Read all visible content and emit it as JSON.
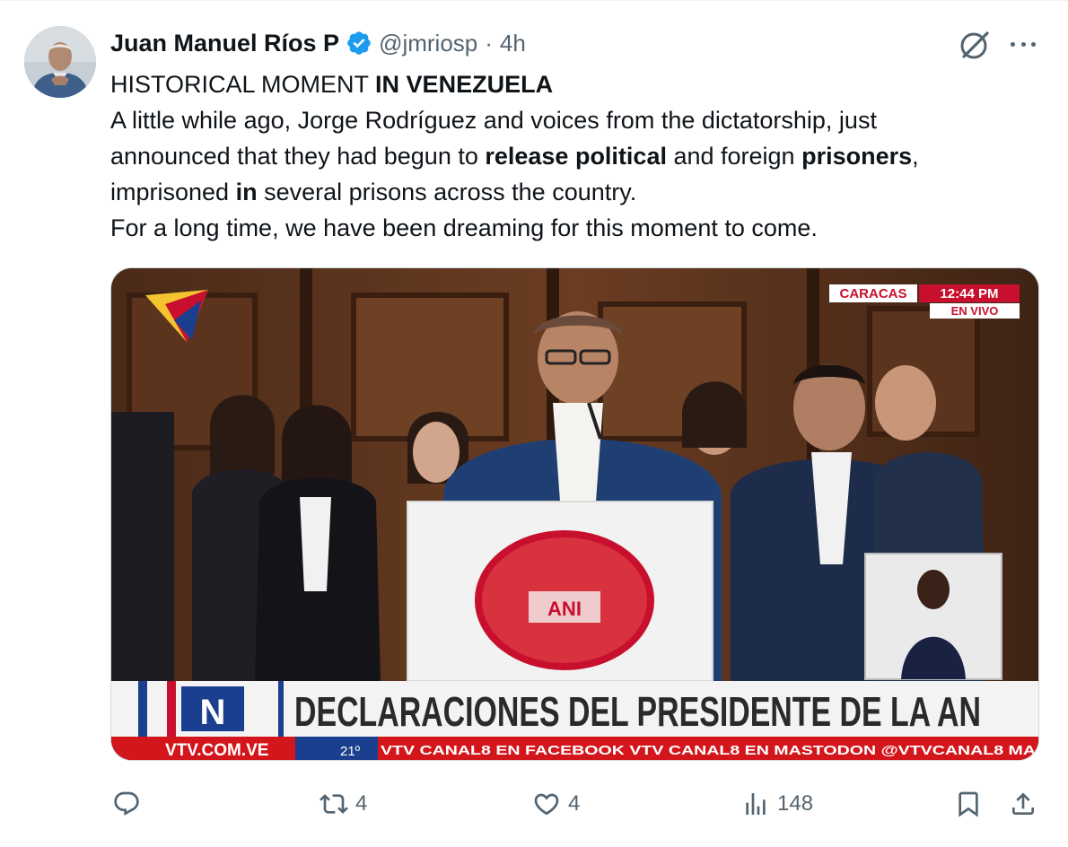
{
  "tweet": {
    "author_name": "Juan Manuel Ríos P",
    "handle": "@jmriosp",
    "separator": "·",
    "time": "4h",
    "text": {
      "l1_a": "HISTORICAL MOMENT ",
      "l1_b": "IN VENEZUELA",
      "l2": "A little while ago, Jorge Rodríguez and voices from the dictatorship, just",
      "l3_a": "announced that they had begun to ",
      "l3_b": "release political",
      "l3_c": " and foreign ",
      "l3_d": "prisoners",
      "l3_e": ",",
      "l4_a": "imprisoned ",
      "l4_b": "in",
      "l4_c": " several prisons across the country.",
      "l5": "For a long time, we have been dreaming for this moment to come."
    }
  },
  "media": {
    "location": "CARACAS",
    "clock": "12:44 PM",
    "live": "EN VIVO",
    "channel_letter": "N",
    "headline": "DECLARACIONES DEL PRESIDENTE DE LA AN",
    "site": "VTV.COM.VE",
    "temperature": "21º",
    "ticker": "VTV CANAL8  EN FACEBOOK VTV CANAL8  EN MASTODON @VTVCANAL8  MA",
    "podium_seal": "ANI"
  },
  "actions": {
    "reply_count": "",
    "retweet_count": "4",
    "like_count": "4",
    "views_count": "148"
  },
  "colors": {
    "verified_blue": "#1d9bf0",
    "secondary_text": "#536471",
    "primary_text": "#0f1419",
    "ticker_red": "#d3161b"
  },
  "icons": [
    "verified-badge-icon",
    "grok-icon",
    "more-icon",
    "reply-icon",
    "retweet-icon",
    "like-icon",
    "views-icon",
    "bookmark-icon",
    "share-icon"
  ]
}
